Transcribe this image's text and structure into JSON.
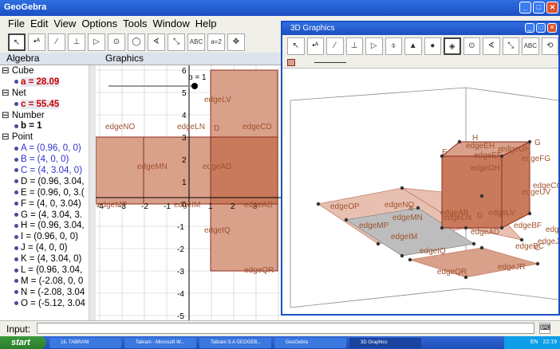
{
  "window": {
    "title": "GeoGebra"
  },
  "menu": [
    "File",
    "Edit",
    "View",
    "Options",
    "Tools",
    "Window",
    "Help"
  ],
  "toolbar": {
    "icons": [
      "move-icon",
      "point-icon",
      "line-icon",
      "perpendicular-icon",
      "polygon-icon",
      "circle-icon",
      "circle-3pt-icon",
      "angle-icon",
      "reflect-icon",
      "text-icon",
      "slider-icon",
      "move-view-icon"
    ],
    "text_tool": "ABC",
    "slider_tool": "a=2"
  },
  "algebra": {
    "title": "Algebra",
    "rows": [
      {
        "type": "cat",
        "text": "Cube"
      },
      {
        "type": "item",
        "style": "red",
        "text": "a = 28.09"
      },
      {
        "type": "cat",
        "text": "Net"
      },
      {
        "type": "item",
        "style": "red",
        "text": "c = 55.45"
      },
      {
        "type": "cat",
        "text": "Number"
      },
      {
        "type": "item",
        "style": "bold",
        "text": "b = 1"
      },
      {
        "type": "cat",
        "text": "Point"
      },
      {
        "type": "item",
        "style": "blue",
        "text": "A = (0.96, 0, 0)"
      },
      {
        "type": "item",
        "style": "blue",
        "text": "B = (4, 0, 0)"
      },
      {
        "type": "item",
        "style": "blue",
        "text": "C = (4, 3.04, 0)"
      },
      {
        "type": "item",
        "style": "",
        "text": "D = (0.96, 3.04,"
      },
      {
        "type": "item",
        "style": "",
        "text": "E = (0.96, 0, 3.("
      },
      {
        "type": "item",
        "style": "",
        "text": "F = (4, 0, 3.04)"
      },
      {
        "type": "item",
        "style": "",
        "text": "G = (4, 3.04, 3."
      },
      {
        "type": "item",
        "style": "",
        "text": "H = (0.96, 3.04,"
      },
      {
        "type": "item",
        "style": "",
        "text": "I = (0.96, 0, 0)"
      },
      {
        "type": "item",
        "style": "",
        "text": "J = (4, 0, 0)"
      },
      {
        "type": "item",
        "style": "",
        "text": "K = (4, 3.04, 0)"
      },
      {
        "type": "item",
        "style": "",
        "text": "L = (0.96, 3.04,"
      },
      {
        "type": "item",
        "style": "",
        "text": "M = (-2.08, 0, 0"
      },
      {
        "type": "item",
        "style": "",
        "text": "N = (-2.08, 3.04"
      },
      {
        "type": "item",
        "style": "",
        "text": "O = (-5.12, 3.04"
      }
    ]
  },
  "graphics": {
    "title": "Graphics",
    "slider_label": "b = 1",
    "x_ticks": [
      "-4",
      "-3",
      "-2",
      "-1",
      "1",
      "2",
      "3"
    ],
    "y_ticks": [
      "6",
      "5",
      "4",
      "3",
      "2",
      "1",
      "0",
      "-1",
      "-2",
      "-3",
      "-4",
      "-5"
    ],
    "labels": [
      "edgeLV",
      "edgeNO",
      "edgeLN",
      "edgeCD",
      "edgeMN",
      "edgeAD",
      "edgeMP",
      "edgeIM",
      "edgeAB",
      "edgeIQ",
      "edgeQR",
      "D"
    ]
  },
  "view3d": {
    "title": "3D Graphics",
    "text_tool": "ABC",
    "labels": [
      "H",
      "E",
      "F",
      "G",
      "edgeEH",
      "edgeEF",
      "edgeGH",
      "edgeFG",
      "edgeDH",
      "edgeOP",
      "edgeNO",
      "a",
      "edgeMN",
      "edgeAB",
      "edgeLN",
      "edgeLV",
      "edgeMP",
      "edgeCG",
      "edgeIM",
      "edgeAD",
      "edgeJS",
      "edgeIQ",
      "edgeBF",
      "edgeBC",
      "edgeQR",
      "edgeJR",
      "edgeCD",
      "edgeUV",
      "D",
      "C"
    ]
  },
  "input": {
    "label": "Input:"
  },
  "taskbar": {
    "start": "start",
    "tasks": [
      "16. TABRANI",
      "Tabrani - Microsoft W...",
      "Tabrani S.A GEOGEB...",
      "GeoGebra",
      "3D Graphics"
    ],
    "lang": "EN",
    "time": "22:19"
  },
  "colors": {
    "face": "#d9a08a",
    "face_dark": "#c97a5c",
    "edge": "#8b2b1e",
    "label": "#a0522d",
    "grid": "#c8c8c8"
  }
}
